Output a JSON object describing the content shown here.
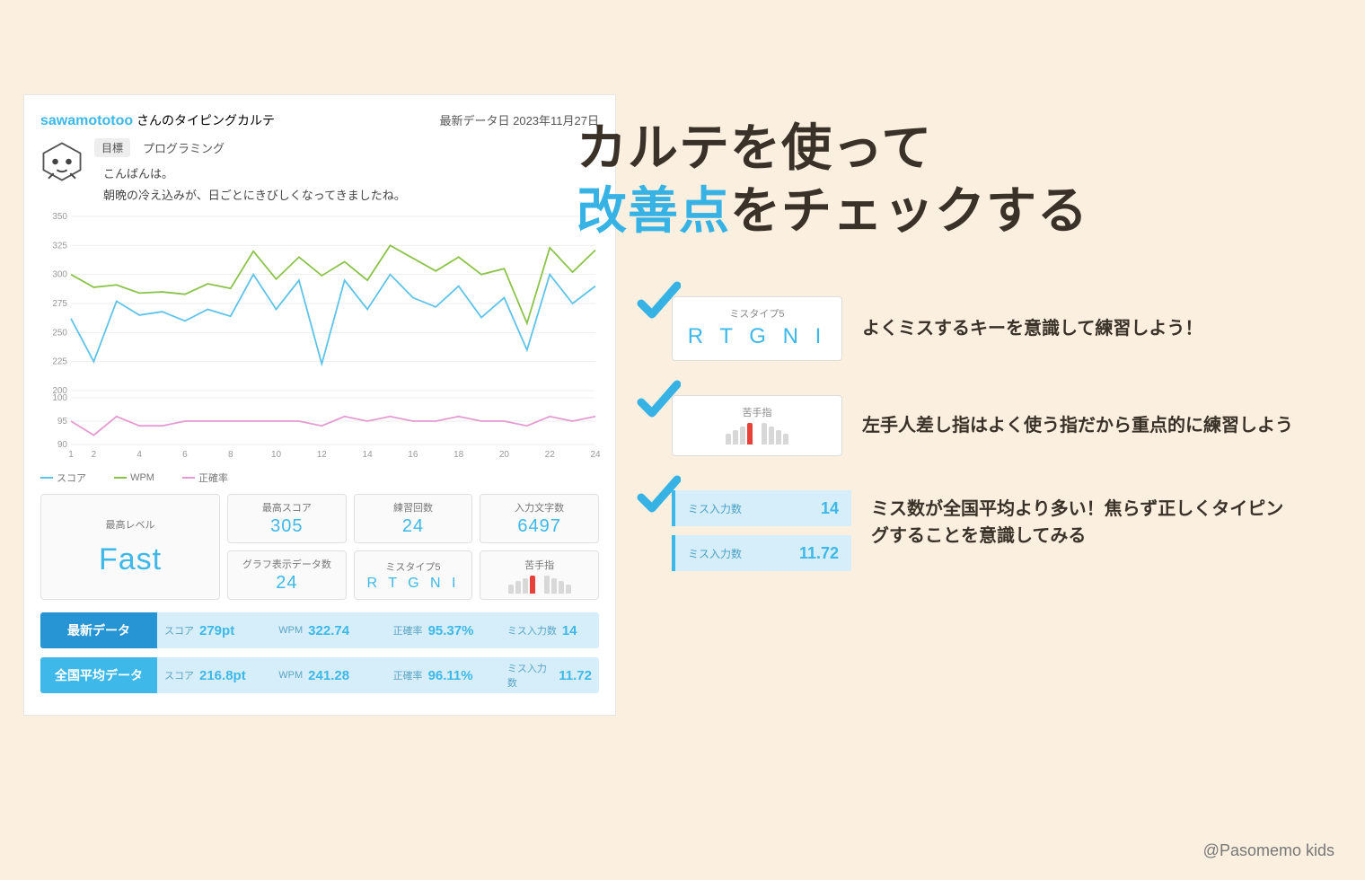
{
  "card": {
    "username": "sawamototoo",
    "title_suffix": " さんのタイピングカルテ",
    "date_label": "最新データ日 2023年11月27日",
    "goal_label": "目標",
    "goal_value": "プログラミング",
    "greeting1": "こんばんは。",
    "greeting2": "朝晩の冷え込みが、日ごとにきびしくなってきましたね。"
  },
  "legend": {
    "score": "スコア",
    "wpm": "WPM",
    "acc": "正確率"
  },
  "stats": {
    "level_label": "最高レベル",
    "level_value": "Fast",
    "max_label": "最高スコア",
    "max_value": "305",
    "practice_label": "練習回数",
    "practice_value": "24",
    "chars_label": "入力文字数",
    "chars_value": "6497",
    "graph_label": "グラフ表示データ数",
    "graph_value": "24",
    "mistype_label": "ミスタイプ5",
    "mistype_value": "R T G N I",
    "finger_label": "苦手指"
  },
  "rows": {
    "latest_tag": "最新データ",
    "avg_tag": "全国平均データ",
    "labels": {
      "score": "スコア",
      "wpm": "WPM",
      "acc": "正確率",
      "miss": "ミス入力数"
    },
    "latest": {
      "score": "279pt",
      "wpm": "322.74",
      "acc": "95.37%",
      "miss": "14"
    },
    "avg": {
      "score": "216.8pt",
      "wpm": "241.28",
      "acc": "96.11%",
      "miss": "11.72"
    }
  },
  "headline": {
    "l1a": "カルテを使って",
    "l2a": "改善点",
    "l2b": "をチェックする"
  },
  "tips": {
    "t1": {
      "label": "ミスタイプ5",
      "value": "R T G N I",
      "text": "よくミスするキーを意識して練習しよう！"
    },
    "t2": {
      "label": "苦手指",
      "text": "左手人差し指はよく使う指だから重点的に練習しよう"
    },
    "t3": {
      "label": "ミス入力数",
      "v1": "14",
      "v2": "11.72",
      "text": "ミス数が全国平均より多い！焦らず正しくタイピングすることを意識してみる"
    }
  },
  "footer": "@Pasomemo kids",
  "chart_data": {
    "type": "line",
    "x": [
      1,
      2,
      3,
      4,
      5,
      6,
      7,
      8,
      9,
      10,
      11,
      12,
      13,
      14,
      15,
      16,
      17,
      18,
      19,
      20,
      21,
      22,
      23,
      24
    ],
    "series": [
      {
        "name": "スコア",
        "values": [
          262,
          225,
          277,
          265,
          268,
          260,
          270,
          264,
          300,
          270,
          295,
          223,
          295,
          270,
          300,
          280,
          272,
          290,
          263,
          280,
          235,
          300,
          275,
          290
        ],
        "color": "#5fc3e8"
      },
      {
        "name": "WPM",
        "values": [
          300,
          289,
          291,
          284,
          285,
          283,
          292,
          288,
          320,
          296,
          315,
          299,
          311,
          295,
          325,
          314,
          303,
          315,
          300,
          305,
          258,
          323,
          302,
          321
        ],
        "color": "#8bc34a"
      },
      {
        "name": "正確率",
        "values": [
          95,
          92,
          96,
          94,
          94,
          95,
          95,
          95,
          95,
          95,
          95,
          94,
          96,
          95,
          96,
          95,
          95,
          96,
          95,
          95,
          94,
          96,
          95,
          96
        ],
        "color": "#e59ad1"
      }
    ],
    "y_primary_ticks": [
      200,
      225,
      250,
      275,
      300,
      325,
      350
    ],
    "y_secondary_ticks": [
      90,
      95,
      100
    ],
    "xlabel": "",
    "ylabel": "",
    "ylim_primary": [
      200,
      350
    ],
    "ylim_secondary": [
      90,
      100
    ]
  }
}
